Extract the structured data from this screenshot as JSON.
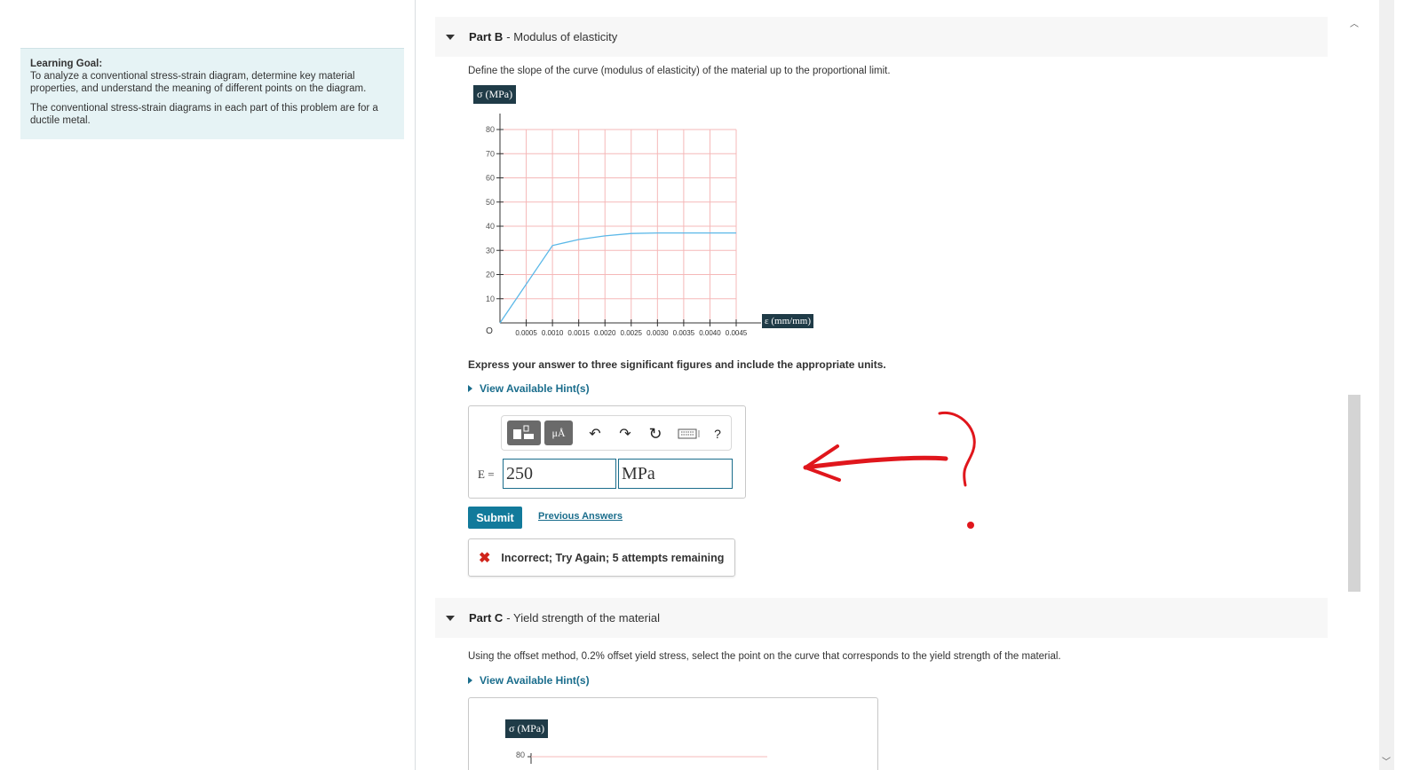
{
  "learning_goal": {
    "title": "Learning Goal:",
    "text": "To analyze a conventional stress-strain diagram, determine key material properties, and understand the meaning of different points on the diagram.",
    "note": "The conventional stress-strain diagrams in each part of this problem are for a ductile metal."
  },
  "part_b": {
    "name": "Part B",
    "title": "- Modulus of elasticity",
    "instruction": "Define the slope of the curve (modulus of elasticity) of the material up to the proportional limit.",
    "y_axis_label": "σ (MPa)",
    "x_axis_label": "ε (mm/mm)",
    "express": "Express your answer to three significant figures and include the appropriate units.",
    "hint": "View Available Hint(s)",
    "answer_label": "E =",
    "answer_value": "250",
    "answer_units": "MPa",
    "submit": "Submit",
    "previous_answers": "Previous Answers",
    "feedback": "Incorrect; Try Again; 5 attempts remaining"
  },
  "toolbar": {
    "templates_icon": "templates-icon",
    "units_label": "μÅ",
    "undo_icon": "undo-icon",
    "redo_icon": "redo-icon",
    "reset_icon": "reset-icon",
    "keyboard_icon": "keyboard-icon",
    "help_label": "?"
  },
  "part_c": {
    "name": "Part C",
    "title": "- Yield strength of the material",
    "instruction": "Using the offset method, 0.2% offset yield stress, select the point on the curve that corresponds to the yield strength of the material.",
    "hint": "View Available Hint(s)",
    "y_axis_label": "σ (MPa)",
    "y_first_tick": "80"
  },
  "chart_data": {
    "type": "line",
    "xlabel": "ε (mm/mm)",
    "ylabel": "σ (MPa)",
    "xlim": [
      0,
      0.0045
    ],
    "ylim": [
      0,
      80
    ],
    "x_ticks": [
      "0.0005",
      "0.0010",
      "0.0015",
      "0.0020",
      "0.0025",
      "0.0030",
      "0.0035",
      "0.0040",
      "0.0045"
    ],
    "y_ticks": [
      "10",
      "20",
      "30",
      "40",
      "50",
      "60",
      "70",
      "80"
    ],
    "origin_label": "O",
    "grid": true,
    "series": [
      {
        "x": [
          0,
          0.001,
          0.0015,
          0.002,
          0.0025,
          0.003,
          0.0035,
          0.004,
          0.0045
        ],
        "y": [
          0,
          32,
          34.5,
          36,
          37,
          37.2,
          37.2,
          37.2,
          37.2
        ]
      }
    ],
    "colors": {
      "line": "#5bb8e8",
      "grid": "#f5b8b8"
    }
  }
}
